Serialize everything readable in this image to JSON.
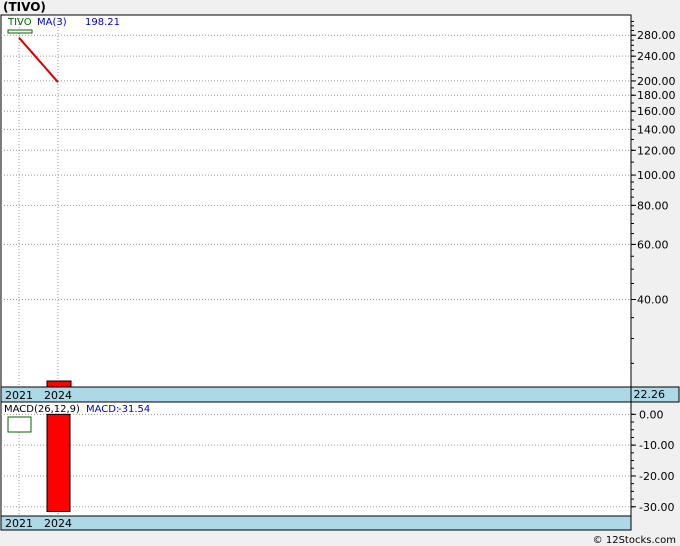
{
  "page": {
    "title": "(TIVO)",
    "footer": "© 12Stocks.com"
  },
  "colors": {
    "background": "#f0f0f0",
    "panel": "#ffffff",
    "axis_band": "#add8e6",
    "price_line": "#dd0000",
    "bar": "#ff0000",
    "ma_text": "#0000cc",
    "ticker_text": "#006600"
  },
  "chart_data": [
    {
      "type": "line",
      "ticker": "TIVO",
      "indicator_label": "MA(3)",
      "indicator_value": "198.21",
      "last_price": "22.26",
      "y_scale": "log",
      "ylim": [
        21,
        325
      ],
      "y_ticks": [
        "280.00",
        "240.00",
        "200.00",
        "180.00",
        "160.00",
        "140.00",
        "120.00",
        "100.00",
        "80.00",
        "60.00",
        "40.00"
      ],
      "x_labels": [
        "2021",
        "2024"
      ],
      "series": [
        {
          "values": [
            275,
            198.21
          ]
        }
      ],
      "volume_bar": {
        "x": "2024"
      }
    },
    {
      "type": "bar",
      "title": "MACD(26,12,9)",
      "macd_label": "MACD:",
      "macd_value": "-31.54",
      "ylim": [
        -33,
        4
      ],
      "y_ticks": [
        "0.00",
        "-10.00",
        "-20.00",
        "-30.00"
      ],
      "x_labels": [
        "2021",
        "2024"
      ],
      "bars": [
        {
          "x": "2024",
          "value": -31.54
        }
      ]
    }
  ]
}
